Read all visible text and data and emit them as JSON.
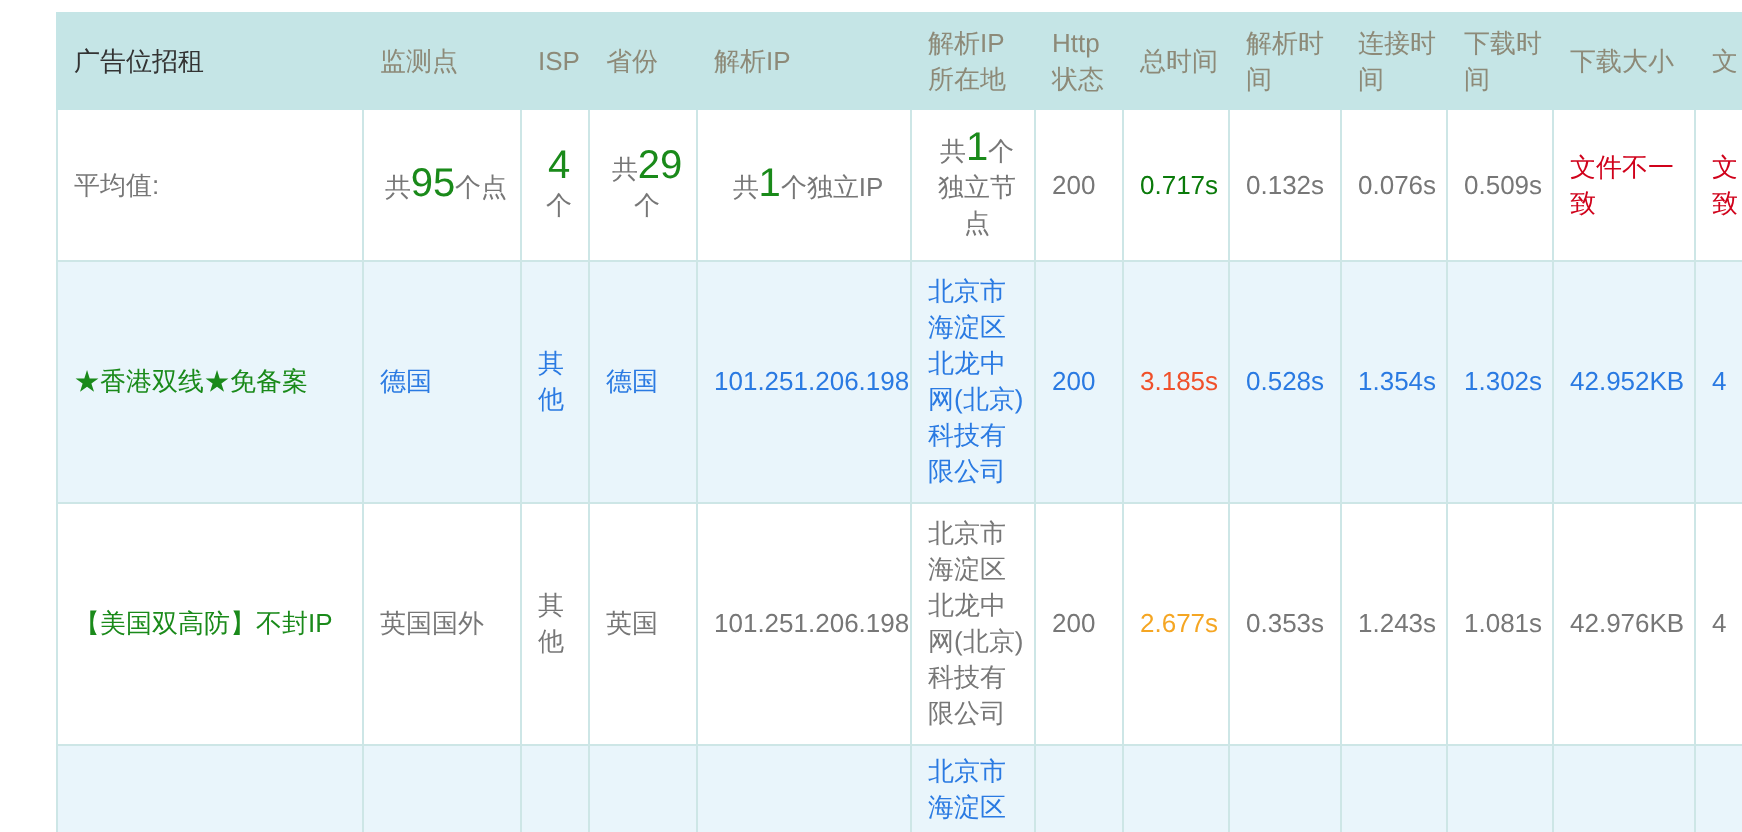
{
  "table": {
    "columns": [
      "广告位招租",
      "监测点",
      "ISP",
      "省份",
      "解析IP",
      "解析IP所在地",
      "Http状态",
      "总时间",
      "解析时间",
      "连接时间",
      "下载时间",
      "下载大小",
      "文"
    ],
    "rows": [
      {
        "kind": "average",
        "highlighted": false,
        "cells": [
          {
            "text": "平均值:"
          },
          {
            "kind": "count",
            "prefix": "共",
            "count": "95",
            "suffix": "个点"
          },
          {
            "kind": "count",
            "count": "4",
            "suffix": "个"
          },
          {
            "kind": "count",
            "prefix": "共",
            "count": "29",
            "suffix": "个"
          },
          {
            "kind": "count",
            "prefix": "共",
            "count": "1",
            "suffix": "个独立IP"
          },
          {
            "kind": "count",
            "prefix": "共",
            "count": "1",
            "suffix": "个独立节点"
          },
          {
            "text": "200"
          },
          {
            "text": "0.717s",
            "color": "#0a7a0a"
          },
          {
            "text": "0.132s"
          },
          {
            "text": "0.076s"
          },
          {
            "text": "0.509s"
          },
          {
            "text": "文件不一致",
            "color": "#d0021b"
          },
          {
            "text": "文致",
            "color": "#d0021b"
          }
        ]
      },
      {
        "kind": "probe",
        "highlighted": true,
        "cells": [
          {
            "text": "★香港双线★免备案",
            "color": "#1a8a1a"
          },
          {
            "text": "德国"
          },
          {
            "text": "其他"
          },
          {
            "text": "德国"
          },
          {
            "text": "101.251.206.198"
          },
          {
            "text": "北京市海淀区北龙中网(北京)科技有限公司"
          },
          {
            "text": "200"
          },
          {
            "text": "3.185s",
            "color": "#f0502a"
          },
          {
            "text": "0.528s"
          },
          {
            "text": "1.354s"
          },
          {
            "text": "1.302s"
          },
          {
            "text": "42.952KB"
          },
          {
            "text": "4"
          }
        ]
      },
      {
        "kind": "probe",
        "highlighted": false,
        "cells": [
          {
            "text": "【美国双高防】不封IP",
            "color": "#1a8a1a"
          },
          {
            "text": "英国国外"
          },
          {
            "text": "其他"
          },
          {
            "text": "英国"
          },
          {
            "text": "101.251.206.198"
          },
          {
            "text": "北京市海淀区北龙中网(北京)科技有限公司"
          },
          {
            "text": "200"
          },
          {
            "text": "2.677s",
            "color": "#f5a623"
          },
          {
            "text": "0.353s"
          },
          {
            "text": "1.243s"
          },
          {
            "text": "1.081s"
          },
          {
            "text": "42.976KB"
          },
          {
            "text": "4"
          }
        ]
      },
      {
        "kind": "partial",
        "highlighted": true,
        "cells": [
          null,
          null,
          null,
          null,
          null,
          {
            "text": "北京市海淀区"
          },
          null,
          null,
          null,
          null,
          null,
          null,
          null
        ]
      }
    ]
  }
}
